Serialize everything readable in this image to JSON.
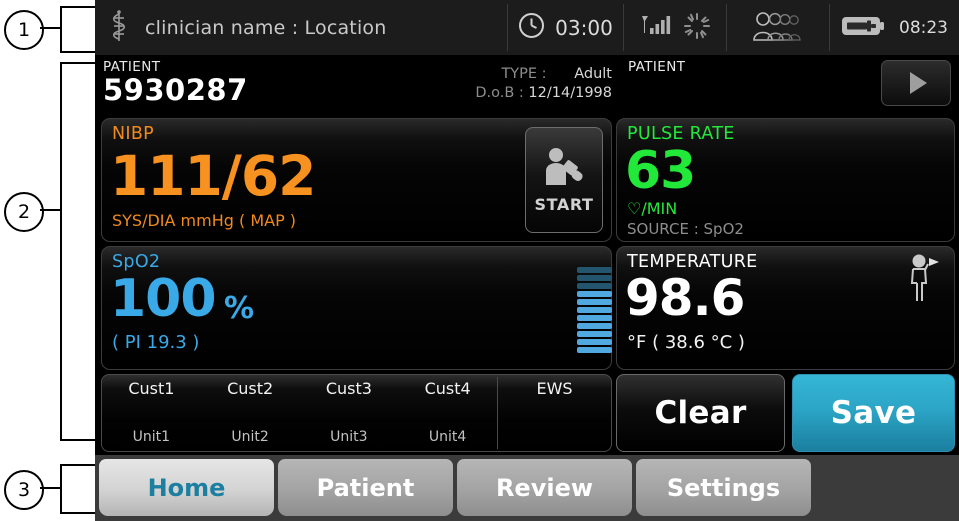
{
  "annotations": [
    {
      "number": "1"
    },
    {
      "number": "2"
    },
    {
      "number": "3"
    }
  ],
  "statusbar": {
    "clinician_icon": "caduceus-icon",
    "clinician_text": "clinician name : Location",
    "clock_icon": "clock-icon",
    "clock_value": "03:00",
    "signal_icon": "wifi-signal-icon",
    "spinner_icon": "activity-spinner-icon",
    "people_icon": "patients-group-icon",
    "battery_icon": "battery-charging-icon",
    "battery_time": "08:23"
  },
  "patient_header": {
    "label": "PATIENT",
    "id": "5930287",
    "type_label": "TYPE :",
    "type_value": "Adult",
    "dob_label": "D.o.B :",
    "dob_value": "12/14/1998",
    "right_label": "PATIENT",
    "next_icon": "play-arrow-icon"
  },
  "nibp": {
    "title": "NIBP",
    "value": "111/62",
    "units": "SYS/DIA mmHg ( MAP )",
    "start_label": "START",
    "start_icon": "bp-cuff-person-icon",
    "color": "#f79221"
  },
  "pulse": {
    "title": "PULSE RATE",
    "value": "63",
    "units": "♡/MIN",
    "source": "SOURCE : SpO2",
    "color": "#22e839"
  },
  "spo2": {
    "title": "SpO2",
    "value": "100",
    "percent": "%",
    "pi": "( PI 19.3 )",
    "color": "#3aa9e8",
    "bar_meter": {
      "name": "pulse-amplitude-bars",
      "total": 11,
      "lit": 8,
      "dim_color": "#23556f",
      "lit_color": "#4fa9e0"
    }
  },
  "temperature": {
    "title": "TEMPERATURE",
    "value": "98.6",
    "units": "°F  ( 38.6 °C )",
    "site_icon": "temporal-thermometer-person-icon",
    "color": "#ffffff"
  },
  "custom_row": {
    "cells": [
      {
        "title": "Cust1",
        "unit": "Unit1"
      },
      {
        "title": "Cust2",
        "unit": "Unit2"
      },
      {
        "title": "Cust3",
        "unit": "Unit3"
      },
      {
        "title": "Cust4",
        "unit": "Unit4"
      }
    ],
    "ews_title": "EWS"
  },
  "actions": {
    "clear_label": "Clear",
    "save_label": "Save",
    "save_color": "#2ca5c6"
  },
  "tabs": [
    {
      "label": "Home",
      "active": true
    },
    {
      "label": "Patient",
      "active": false
    },
    {
      "label": "Review",
      "active": false
    },
    {
      "label": "Settings",
      "active": false
    }
  ]
}
